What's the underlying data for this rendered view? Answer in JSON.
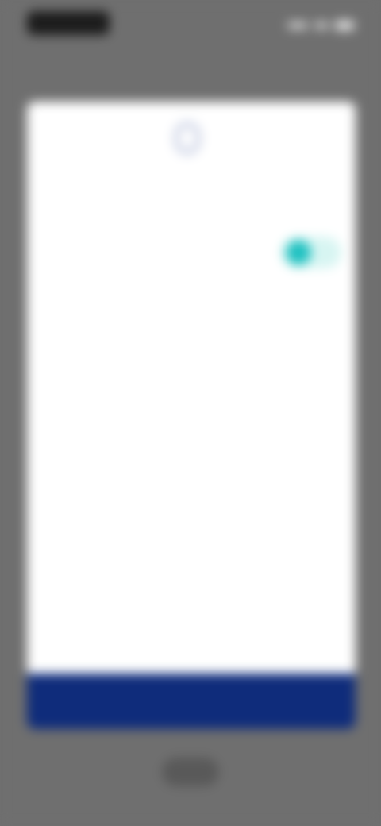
{
  "status_bar": {
    "time": "",
    "signal_icon": "signal-icon",
    "wifi_icon": "wifi-icon",
    "battery_icon": "battery-icon"
  },
  "sheet": {
    "icon": "shield-icon",
    "title": "",
    "rows": [
      {
        "label": "",
        "control": "toggle",
        "state": "on"
      },
      {
        "label": "",
        "value": ""
      }
    ]
  },
  "bottom_bar": {
    "button_label": ""
  },
  "colors": {
    "overlay": "#6f6f6f",
    "sheet": "#ffffff",
    "accent": "#1fc1c1",
    "primary_bar": "#0f2c7b"
  }
}
